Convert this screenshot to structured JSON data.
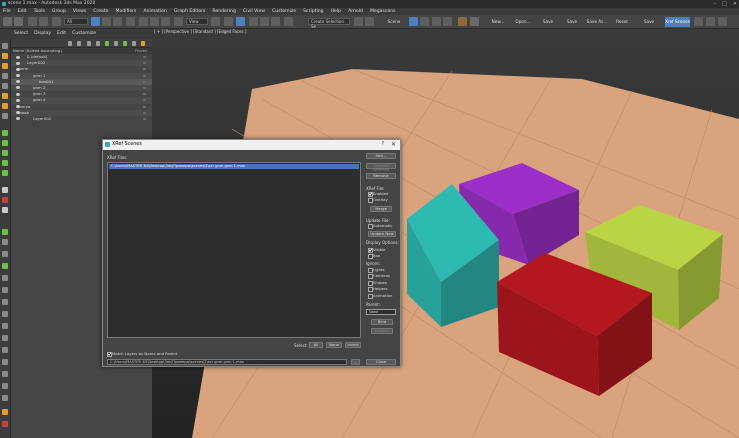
{
  "window": {
    "title": "scene 1.max - Autodesk 3ds Max 2020",
    "controls": [
      "–",
      "□",
      "✕"
    ]
  },
  "menu": [
    "File",
    "Edit",
    "Tools",
    "Group",
    "Views",
    "Create",
    "Modifiers",
    "Animation",
    "Graph Editors",
    "Rendering",
    "Civil View",
    "Customize",
    "Scripting",
    "Help",
    "Arnold",
    "Megascans"
  ],
  "toolbar": {
    "filter_value": "All",
    "view_value": "View",
    "selection_set": "Create Selection Se",
    "scene_explorer_label": "Scene Explorer",
    "text_buttons": [
      "New...",
      "Open...",
      "Save",
      "Save Copy",
      "Save As...",
      "Reset",
      "Save Selection",
      "Xref Scenes"
    ]
  },
  "command_tabs": [
    "Select",
    "Display",
    "Edit",
    "Customize"
  ],
  "explorer": {
    "header_name": "Name (Sorted Ascending)",
    "header_col2": "Frozen",
    "rows": [
      {
        "label": "0 (default)",
        "indent": 16
      },
      {
        "label": "Layer002",
        "indent": 16
      },
      {
        "label": "dome",
        "indent": 6
      },
      {
        "label": "gnm 1",
        "indent": 22
      },
      {
        "label": "box001",
        "indent": 28
      },
      {
        "label": "gnm 2",
        "indent": 22
      },
      {
        "label": "gnm 3",
        "indent": 22
      },
      {
        "label": "gnm 4",
        "indent": 22
      },
      {
        "label": "yomya",
        "indent": 6
      },
      {
        "label": "aaaaa",
        "indent": 6
      },
      {
        "label": "Layer002",
        "indent": 22
      }
    ]
  },
  "viewport": {
    "label": "[ + ] [Perspective ] [Standard ] [Edged Faces ]"
  },
  "dialog": {
    "title": "XRef Scenes",
    "help": "?",
    "close": "✕",
    "list_label": "XRef Files:",
    "files": [
      "C:\\Users\\MASTER 3D\\Desktop\\3ds\\Примеры\\scenes\\2\\scr gnm gnm 1.max"
    ],
    "buttons": {
      "add": "Add...",
      "convert": "Convert Selected",
      "remove": "Remove",
      "merge": "Merge",
      "update": "Update Now",
      "bind": "Bind",
      "unbind": "Unbind",
      "close": "Close",
      "browse": "...",
      "select_all": "All",
      "select_none": "None",
      "select_invert": "Invert"
    },
    "xref_file_label": "XRef File:",
    "enabled": "Enabled",
    "overlay": "Overlay",
    "update_file_label": "Update File:",
    "automatic": "Automatic",
    "display_options_label": "Display Options:",
    "visible": "Visible",
    "box": "Box",
    "ignore_label": "Ignore:",
    "lights": "Lights",
    "cameras": "Cameras",
    "shapes": "Shapes",
    "helpers": "Helpers",
    "animation": "Animation",
    "parent_label": "Parent:",
    "parent_value": "None",
    "select_label": "Select:",
    "match_layers": "Match Layers by Name and Parent",
    "path": "C:\\Users\\MASTER 3D\\Desktop\\3ds\\Примеры\\scenes\\2\\scr gnm gnm 1.max"
  },
  "colors": {
    "floor": "#d8a37d",
    "accent": "#4d7fbf",
    "teal": "#2aa9a0",
    "purple": "#8e2bb5",
    "lime": "#a8c13f",
    "red": "#a3161c"
  }
}
